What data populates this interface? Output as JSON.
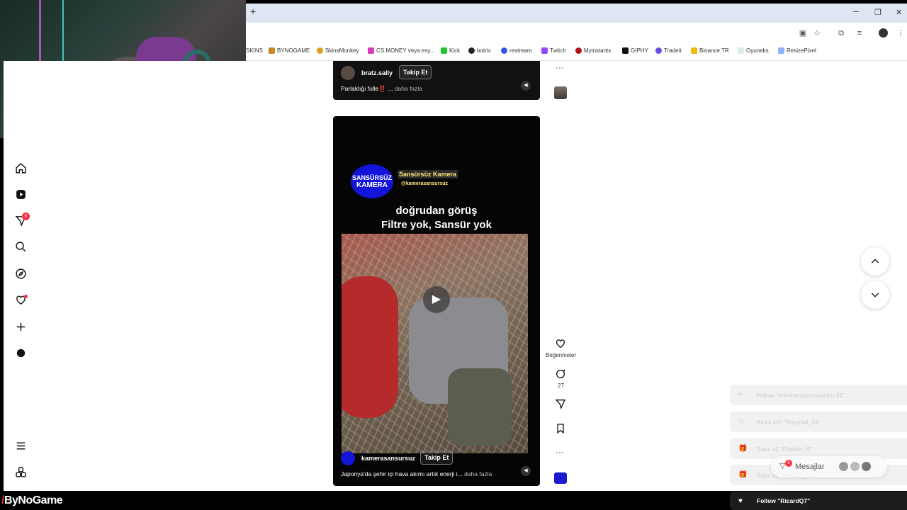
{
  "browser": {
    "new_tab": "+",
    "win_min": "─",
    "win_max": "❐",
    "win_close": "✕",
    "bookmarks": [
      {
        "label": "SKINS",
        "color": "#ffffff"
      },
      {
        "label": "BYNOGAME",
        "color": "#c48a26"
      },
      {
        "label": "SkinsMonkey",
        "color": "#d8a316"
      },
      {
        "label": "CS.MONEY veya esy...",
        "color": "#d63bb8"
      },
      {
        "label": "Kick",
        "color": "#22c42b"
      },
      {
        "label": "botrix",
        "color": "#222222"
      },
      {
        "label": "restream",
        "color": "#2f56e0"
      },
      {
        "label": "Twitch",
        "color": "#9146ff"
      },
      {
        "label": "Myinstants",
        "color": "#b3121b"
      },
      {
        "label": "GIPHY",
        "color": "#111111"
      },
      {
        "label": "Tradeit",
        "color": "#6a4de0"
      },
      {
        "label": "Binance TR",
        "color": "#f0b90b"
      },
      {
        "label": "Oyuneks",
        "color": "#d6eee0"
      },
      {
        "label": "ResizePixel",
        "color": "#8fb0ff"
      }
    ]
  },
  "nav": {
    "notifications_count": "6"
  },
  "post_top": {
    "username": "bratz.sally",
    "follow": "Takip Et",
    "caption": "Parlaklığı fulle‼️ ...",
    "more": "daha fazla"
  },
  "post_main": {
    "channel_logo_line1": "SANSÜRSÜZ",
    "channel_logo_line2": "KAMERA",
    "channel_name": "Sansürsüz Kamera",
    "channel_handle": "@kamerasansursuz",
    "headline_line1": "doğrudan görüş",
    "headline_line2": "Filtre yok, Sansür yok",
    "username": "kamerasansursuz",
    "follow": "Takip Et",
    "caption": "Japonya'da şehir içi hava akımı artık enerji i...",
    "more": "daha fazla"
  },
  "actions": {
    "likes_label": "Beğenmeler",
    "comments_count": "27",
    "more": "···"
  },
  "alerts": [
    {
      "icon": "heart-icon",
      "text": "Follow \"enesbaturpurnosakzo31\""
    },
    {
      "icon": "refresh-icon",
      "text": "Kicks x10 \"Raymall_34\""
    },
    {
      "icon": "gift-icon",
      "text": "Subs x1 \"Pamido_R\""
    },
    {
      "icon": "gift-icon",
      "text": "Subs x1 \"Pamido_R\""
    },
    {
      "icon": "heart-icon",
      "text": "Follow \"RicardQ7\""
    }
  ],
  "messages": {
    "label": "Mesajlar",
    "badge": "6"
  },
  "brand": {
    "name": "ByNoGame"
  }
}
